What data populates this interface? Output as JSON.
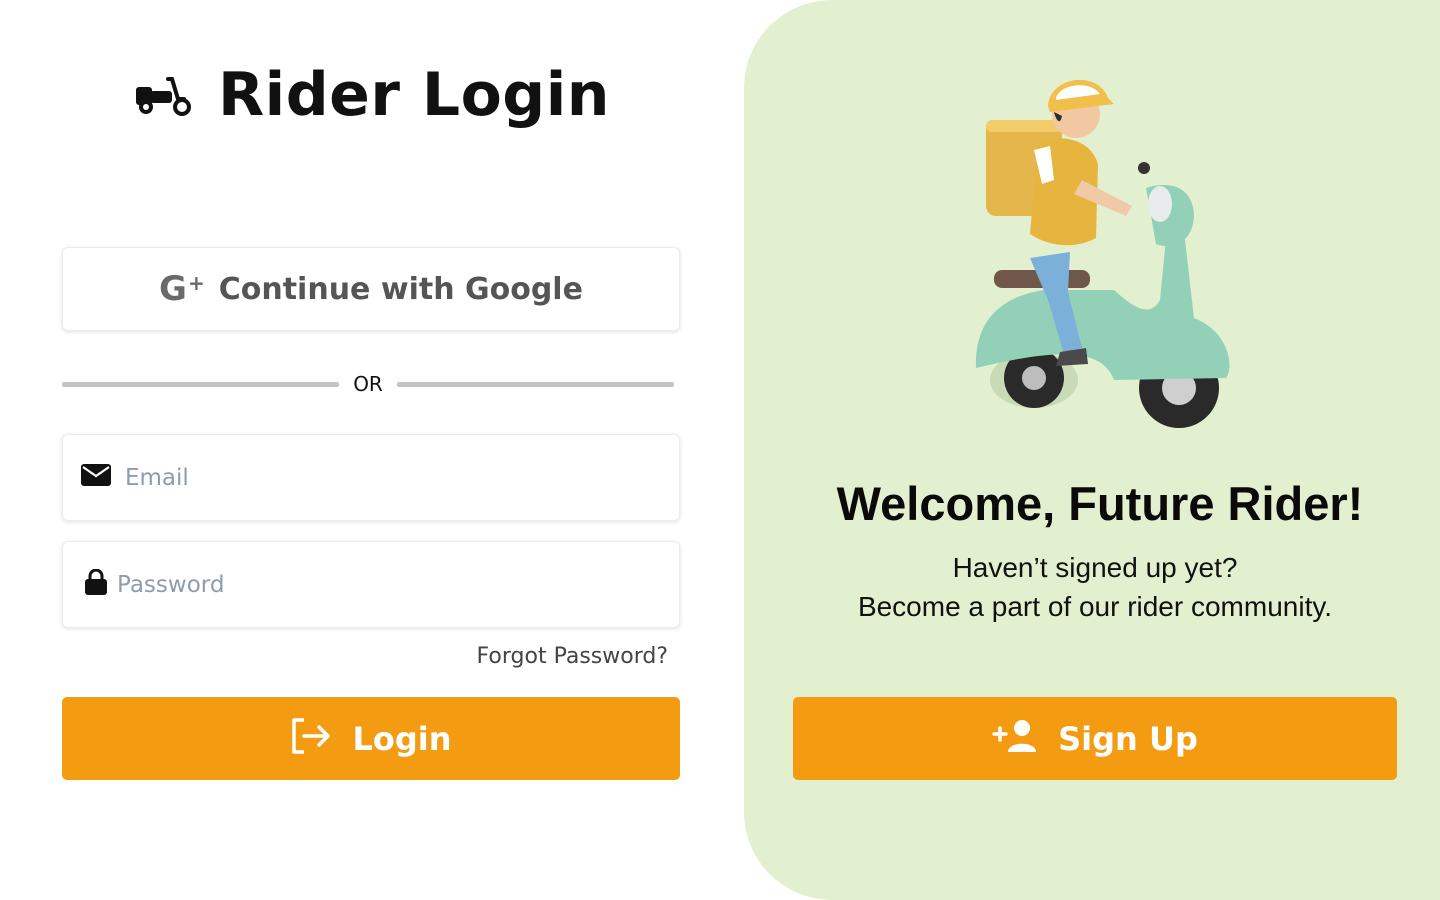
{
  "header": {
    "title": "Rider Login",
    "logo_icon": "scooter-icon"
  },
  "google": {
    "label": "Continue with Google",
    "icon_text": "G",
    "icon_plus": "+"
  },
  "divider": {
    "text": "OR"
  },
  "form": {
    "email_placeholder": "Email",
    "password_placeholder": "Password",
    "forgot_label": "Forgot Password?",
    "login_label": "Login"
  },
  "promo": {
    "title": "Welcome, Future Rider!",
    "line1": "Haven’t signed up yet?",
    "line2": "Become a part of our rider community.",
    "signup_label": "Sign Up"
  },
  "colors": {
    "accent": "#f39c12",
    "panel": "#e2f0cf"
  }
}
